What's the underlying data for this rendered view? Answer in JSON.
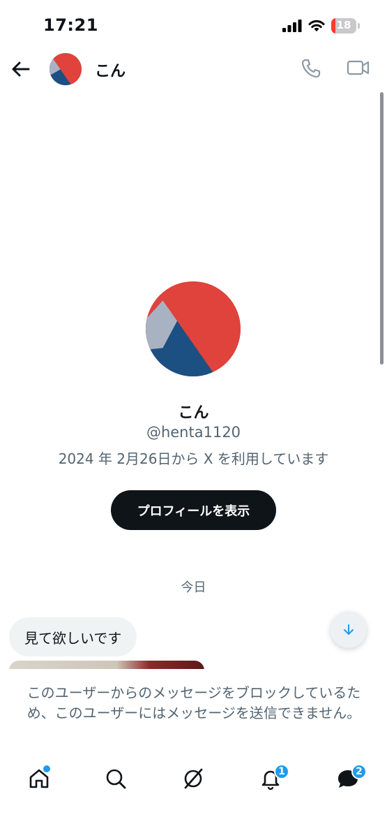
{
  "status_bar": {
    "time": "17:21",
    "battery": "18",
    "battery_level": 0.18
  },
  "header": {
    "name": "こん"
  },
  "profile": {
    "name": "こん",
    "handle": "@henta1120",
    "joined": "2024 年 2月26日から X を利用しています",
    "view_profile_label": "プロフィールを表示"
  },
  "conversation": {
    "date_separator": "今日",
    "messages": [
      {
        "text": "見て欲しいです"
      }
    ]
  },
  "blocked_notice": "このユーザーからのメッセージをブロックしているため、このユーザーにはメッセージを送信できません。",
  "nav": {
    "items": [
      {
        "icon": "home-icon",
        "dot": true
      },
      {
        "icon": "search-icon"
      },
      {
        "icon": "grok-icon"
      },
      {
        "icon": "bell-icon",
        "badge": "1"
      },
      {
        "icon": "messages-icon",
        "badge": "2"
      }
    ]
  },
  "colors": {
    "accent": "#1d9bf0",
    "text": "#0f1419",
    "muted": "#536471",
    "battery_low": "#ff3b30"
  }
}
